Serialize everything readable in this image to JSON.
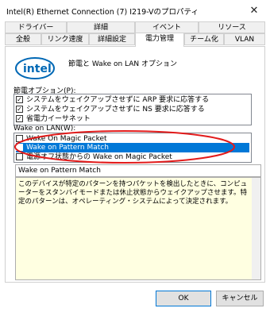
{
  "window": {
    "title": "Intel(R) Ethernet Connection (7) I219-Vのプロパティ"
  },
  "tabs_row1": [
    {
      "label": "ドライバー"
    },
    {
      "label": "詳細"
    },
    {
      "label": "イベント"
    },
    {
      "label": "リソース"
    }
  ],
  "tabs_row2": [
    {
      "label": "全般"
    },
    {
      "label": "リンク速度"
    },
    {
      "label": "詳細設定"
    },
    {
      "label": "電力管理"
    },
    {
      "label": "チーム化"
    },
    {
      "label": "VLAN"
    }
  ],
  "header": {
    "logo_text": "intel",
    "label": "節電と Wake on LAN オプション"
  },
  "power_saving": {
    "label": "節電オプション(P):",
    "items": [
      {
        "label": "システムをウェイクアップさせずに ARP 要求に応答する",
        "checked": true
      },
      {
        "label": "システムをウェイクアップさせずに NS 要求に応答する",
        "checked": true
      },
      {
        "label": "省電力イーサネット",
        "checked": true
      }
    ]
  },
  "wake_on_lan": {
    "label": "Wake on LAN(W):",
    "items": [
      {
        "label": "Wake On Magic Packet",
        "checked": false
      },
      {
        "label": "Wake on Pattern Match",
        "checked": false
      },
      {
        "label": "電源オフ状態からの Wake on Magic Packet",
        "checked": false
      }
    ]
  },
  "description": {
    "title": "Wake on Pattern Match",
    "text": "このデバイスが特定のパターンを持つパケットを検出したときに、コンピューターをスタンバイモードまたは休止状態からウェイクアップさせます。特定のパターンは、オペレーティング・システムによって決定されます。"
  },
  "buttons": {
    "ok": "OK",
    "cancel": "キャンセル"
  }
}
